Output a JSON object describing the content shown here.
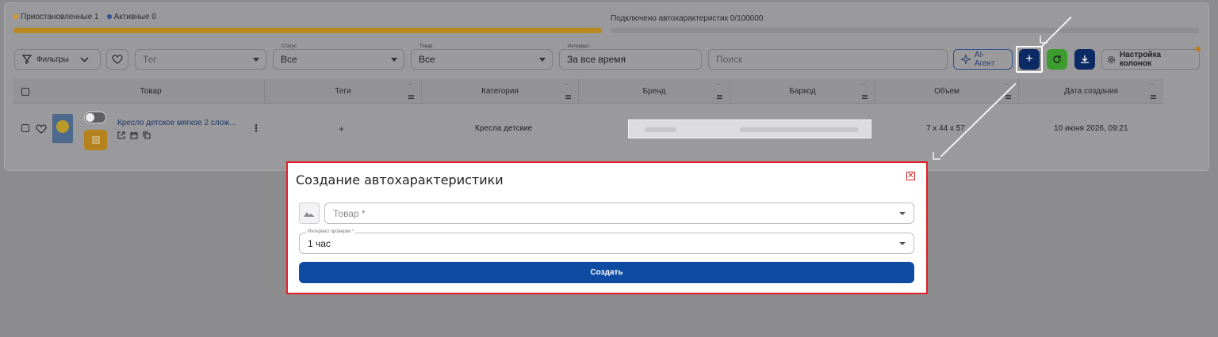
{
  "status": {
    "paused_label": "Приостановленные 1",
    "active_label": "Активные 0",
    "connected_label": "Подключено автохарактеристик 0/100000",
    "colors": {
      "paused": "#d39a1e",
      "active": "#2f4f8f"
    }
  },
  "toolbar": {
    "filters_label": "Фильтры",
    "tag_placeholder": "Тег",
    "status_caption": "Статус",
    "status_value": "Все",
    "product_caption": "Товар",
    "product_value": "Все",
    "interval_caption": "Интервал",
    "interval_value": "За все время",
    "search_placeholder": "Поиск",
    "ai_agent_label": "AI-Агент",
    "add_label": "+",
    "columns_label": "Настройка колонок"
  },
  "table": {
    "headers": [
      "Товар",
      "Теги",
      "Категория",
      "Бренд",
      "Баркод",
      "Объем",
      "Дата создания"
    ],
    "row": {
      "product_name": "Кресло детское мягкое 2 слож...",
      "tags": "+",
      "category": "Кресла детские",
      "volume": "7 x 44 x 57",
      "created": "10 июня 2026, 09:21"
    }
  },
  "modal": {
    "title": "Создание автохарактеристики",
    "close_icon": "close-icon",
    "product_placeholder": "Товар *",
    "interval_caption": "Интервал проверки *",
    "interval_value": "1 час",
    "create_label": "Создать",
    "accent": "#0f4aa3",
    "border": "#e31e24"
  }
}
